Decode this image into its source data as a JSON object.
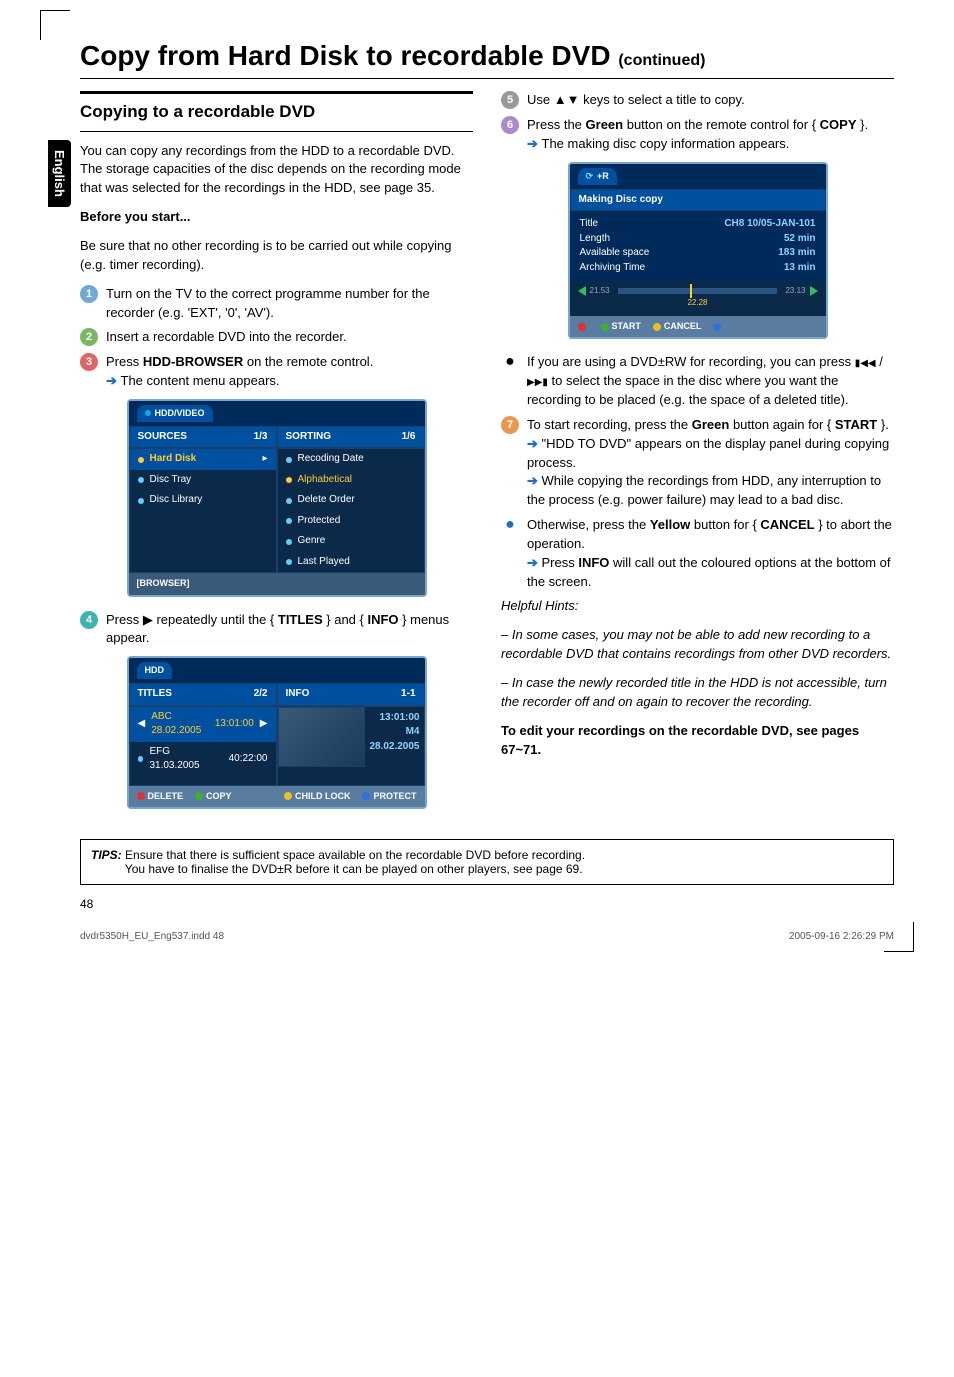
{
  "page": {
    "title_main": "Copy from Hard Disk to recordable DVD ",
    "title_cont": "(continued)",
    "side_tab": "English",
    "page_number": "48"
  },
  "left": {
    "section_title": "Copying to a recordable DVD",
    "intro": "You can copy any recordings from the HDD to a recordable DVD. The storage capacities of the disc depends on the recording mode that was selected for the recordings in the HDD, see page 35.",
    "before_head": "Before you start...",
    "before_body": "Be sure that no other recording is to be carried out while copying (e.g. timer recording).",
    "step1": "Turn on the TV to the correct programme number for the recorder (e.g. 'EXT', '0', 'AV').",
    "step2": "Insert a recordable DVD into the recorder.",
    "step3a": "Press ",
    "step3_btn": "HDD-BROWSER",
    "step3b": " on the remote control.",
    "step3_res": "The content menu appears.",
    "step4a": "Press ▶ repeatedly until the { ",
    "step4_t": "TITLES",
    "step4b": " } and { ",
    "step4_i": "INFO",
    "step4c": " } menus appear."
  },
  "osd1": {
    "top_label": "HDD/VIDEO",
    "src_head": "SOURCES",
    "src_count": "1/3",
    "sort_head": "SORTING",
    "sort_count": "1/6",
    "src_items": [
      "Hard Disk",
      "Disc Tray",
      "Disc Library"
    ],
    "sort_items": [
      "Recoding Date",
      "Alphabetical",
      "Delete Order",
      "Protected",
      "Genre",
      "Last Played"
    ],
    "footer_tag": "[BROWSER]"
  },
  "osd2": {
    "top_label": "HDD",
    "t_head": "TITLES",
    "t_count": "2/2",
    "i_head": "INFO",
    "i_count": "1-1",
    "row1_a": "ABC 28.02.2005",
    "row1_b": "13:01:00",
    "row2_a": "EFG 31.03.2005",
    "row2_b": "40:22:00",
    "info_l1": "13:01:00",
    "info_l2": "M4",
    "info_l3": "28.02.2005",
    "f_del": "DELETE",
    "f_cpy": "COPY",
    "f_cl": "CHILD LOCK",
    "f_pr": "PROTECT"
  },
  "right": {
    "step5": "Use ▲▼ keys to select a title to copy.",
    "step6a": "Press the ",
    "step6_g": "Green",
    "step6b": " button on the remote control for { ",
    "step6_c": "COPY",
    "step6c": " }.",
    "step6_res": "The making disc copy information appears.",
    "bullet1a": "If you are using a DVD±RW for recording, you can press ",
    "bullet1b": " to select the space in the disc where you want the recording to be placed (e.g. the space of a deleted title).",
    "prev_next_sep": " / ",
    "step7a": "To start recording, press the ",
    "step7_g": "Green",
    "step7b": " button again for { ",
    "step7_s": "START",
    "step7c": " }.",
    "step7_res1": "\"HDD TO DVD\" appears on the display panel during copying process.",
    "step7_res2": "While copying the recordings from HDD, any interruption to the process (e.g. power failure) may lead to a bad disc.",
    "bullet2a": "Otherwise, press the ",
    "bullet2_y": "Yellow",
    "bullet2b": " button for { ",
    "bullet2_c": "CANCEL",
    "bullet2c": " } to abort the operation.",
    "bullet2_res_a": "Press ",
    "bullet2_res_btn": "INFO",
    "bullet2_res_b": " will call out the coloured options at the bottom of the screen.",
    "hints_head": "Helpful Hints:",
    "hint1": "– In some cases, you may not be able to add new recording to a recordable DVD that contains recordings from other DVD recorders.",
    "hint2": "– In case the newly recorded title in the HDD is not accessible, turn the recorder off and on again to recover the recording.",
    "edit_note": "To edit your recordings on the recordable DVD, see pages 67~71."
  },
  "osd3": {
    "top_label": "+R",
    "head": "Making Disc copy",
    "r1k": "Title",
    "r1v": "CH8 10/05-JAN-101",
    "r2k": "Length",
    "r2v": "52 min",
    "r3k": "Available space",
    "r3v": "183 min",
    "r4k": "Archiving Time",
    "r4v": "13 min",
    "t_left": "21.53",
    "t_mid": "22.28",
    "t_right": "23.13",
    "f_start": "START",
    "f_cancel": "CANCEL"
  },
  "tips": {
    "label": "TIPS:",
    "line1": "Ensure that there is sufficient space available on the recordable DVD before recording.",
    "line2": "You have to finalise the DVD±R before it can be played on other players, see page 69."
  },
  "footer": {
    "file": "dvdr5350H_EU_Eng537.indd   48",
    "stamp": "2005-09-16   2:26:29 PM"
  }
}
